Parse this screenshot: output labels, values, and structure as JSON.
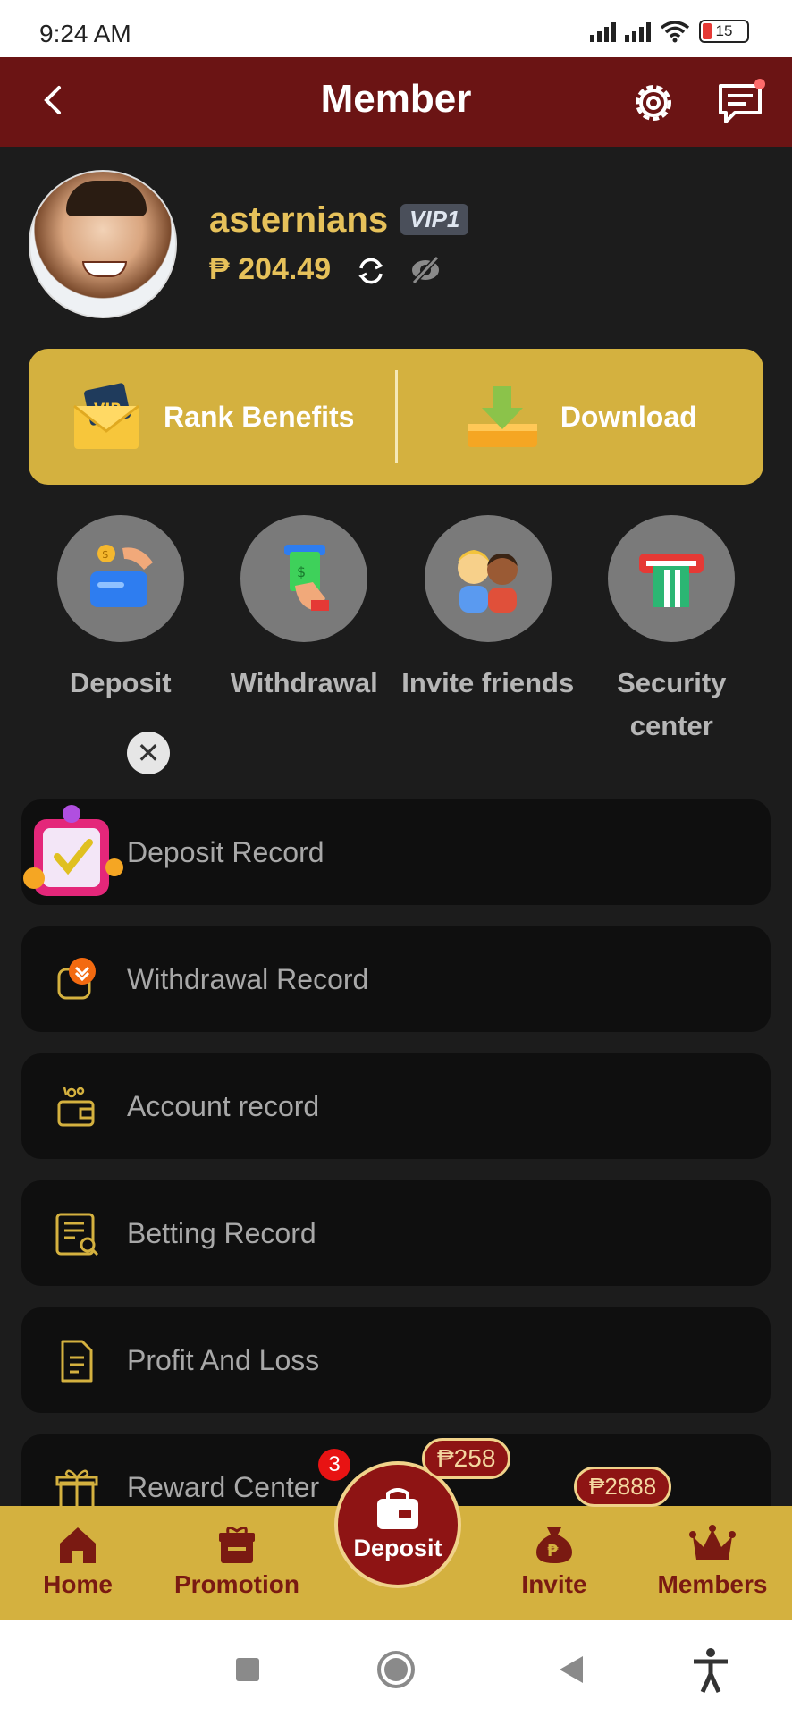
{
  "status_bar": {
    "time": "9:24 AM",
    "battery": "15"
  },
  "header": {
    "title": "Member"
  },
  "profile": {
    "username": "asternians",
    "vip_level": "VIP1",
    "balance": "₱ 204.49"
  },
  "gold_card": {
    "rank_benefits": "Rank Benefits",
    "download": "Download"
  },
  "quick_actions": [
    {
      "label": "Deposit"
    },
    {
      "label": "Withdrawal"
    },
    {
      "label": "Invite friends"
    },
    {
      "label": "Security center"
    }
  ],
  "records": [
    {
      "label": "Deposit Record"
    },
    {
      "label": "Withdrawal Record"
    },
    {
      "label": "Account record"
    },
    {
      "label": "Betting Record"
    },
    {
      "label": "Profit And Loss"
    },
    {
      "label": "Reward Center"
    }
  ],
  "bottom_nav": {
    "home": "Home",
    "promotion": "Promotion",
    "deposit": "Deposit",
    "invite": "Invite",
    "members": "Members",
    "deposit_badge_count": "3",
    "deposit_bonus": "₱258",
    "invite_bonus": "₱2888"
  },
  "colors": {
    "header_bg": "#6b1414",
    "gold": "#d4b13f",
    "accent_text": "#e6c15a"
  }
}
